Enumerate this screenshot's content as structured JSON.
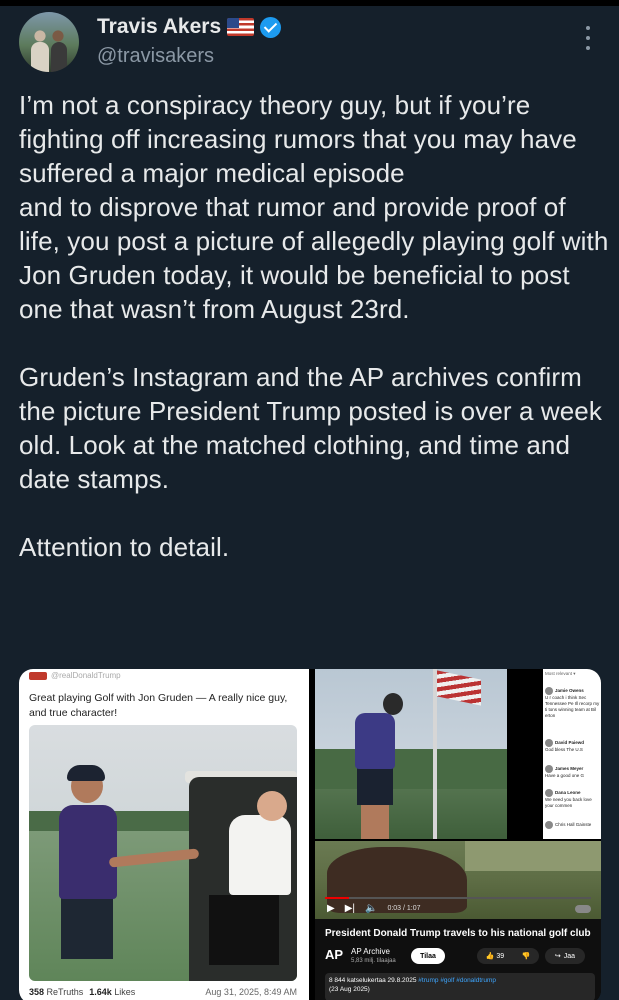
{
  "author": {
    "name": "Travis Akers",
    "handle": "@travisakers",
    "verified": true,
    "flag_icon": "us-flag-icon"
  },
  "tweet": {
    "text": "I’m not a conspiracy theory guy, but if you’re fighting off increasing rumors that you may have suffered a major medical episode\nand to disprove that rumor and provide proof of life, you post a picture of allegedly playing golf with Jon Gruden today, it would be beneficial to post one that wasn’t from August 23rd.\n\nGruden’s Instagram and the AP archives confirm the picture President Trump posted is over a week old. Look at the matched clothing, and time and date stamps.\n\nAttention to detail."
  },
  "media": {
    "truth_post": {
      "handle": "@realDonaldTrump",
      "text": "Great playing Golf with Jon Gruden — A really nice guy, and true character!",
      "retruths_count": "358",
      "retruths_label": "ReTruths",
      "likes_count": "1.64k",
      "likes_label": "Likes",
      "date": "Aug 31, 2025, 8:49 AM"
    },
    "comments": {
      "header": "Most relevant ▾",
      "items": [
        {
          "name": "Jamie Owens",
          "text": "U r coach i think Sec Tennessee Pe Ill recorp my ti tons winning team at Bil erton"
        },
        {
          "name": "David Paiewd",
          "text": "God bless The U.S"
        },
        {
          "name": "James Meyer",
          "text": "Have a good one G"
        },
        {
          "name": "Dana Leone",
          "text": "We need you back love your commen"
        },
        {
          "name": "Chris Hall",
          "text": "Chris Hall Gainste"
        }
      ]
    },
    "ap_video": {
      "time": "0:03 / 1:07",
      "title": "President Donald Trump travels to his national golf club",
      "channel_logo": "AP",
      "channel_name": "AP Archive",
      "subscribers": "5,83 milj. tilaajaa",
      "subscribe_label": "Tilaa",
      "likes": "39",
      "share_label": "Jaa",
      "views": "8 844 katselukertaa 29.8.2025",
      "hashtags": "#trump #golf #donaldtrump",
      "date_stamp": "(23 Aug 2025)"
    }
  }
}
